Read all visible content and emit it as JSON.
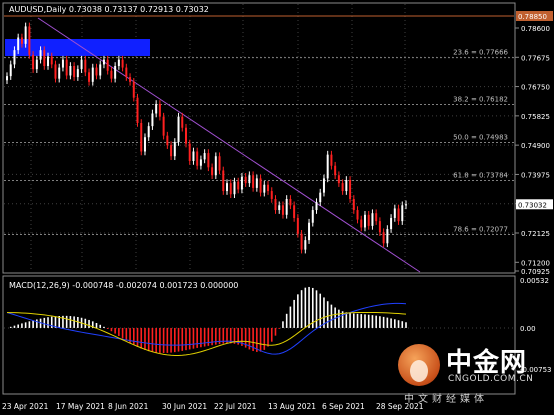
{
  "main_chart": {
    "header": "AUDUSD,Daily  0.73038 0.73137 0.72913 0.73032",
    "price_labels": [
      "0.78600",
      "0.77675",
      "0.76750",
      "0.75825",
      "0.74900",
      "0.73975",
      "0.73050",
      "0.72125",
      "0.71200",
      "0.70925"
    ],
    "top_marker": "0.78850",
    "current_price": "0.73032",
    "fib_levels": [
      {
        "label": "23.6 = 0.77666",
        "value": 0.77666
      },
      {
        "label": "38.2 = 0.76182",
        "value": 0.76182
      },
      {
        "label": "50.0 = 0.74983",
        "value": 0.74983
      },
      {
        "label": "61.8 = 0.73784",
        "value": 0.73784
      },
      {
        "label": "78.6 = 0.72077",
        "value": 0.72077
      }
    ],
    "colors": {
      "bull": "#ffffff",
      "bear": "#ff2020",
      "trendline": "#a050d0",
      "fib": "#808080",
      "zone": "#1020ff",
      "grid": "#404040",
      "top_line": "#c06030"
    }
  },
  "macd": {
    "header": "MACD(12,26,9) -0.000748 -0.002074 0.001723 0.000000",
    "labels": [
      "0.00532",
      "0.00",
      "-0.00753"
    ]
  },
  "x_axis": [
    "23 Apr 2021",
    "17 May 2021",
    "8 Jun 2021",
    "30 Jun 2021",
    "22 Jul 2021",
    "13 Aug 2021",
    "6 Sep 2021",
    "28 Sep 2021"
  ],
  "watermark": {
    "brand": "中金网",
    "url": "CNGOLD.COM.CN",
    "sub": "中文财经媒体"
  }
}
